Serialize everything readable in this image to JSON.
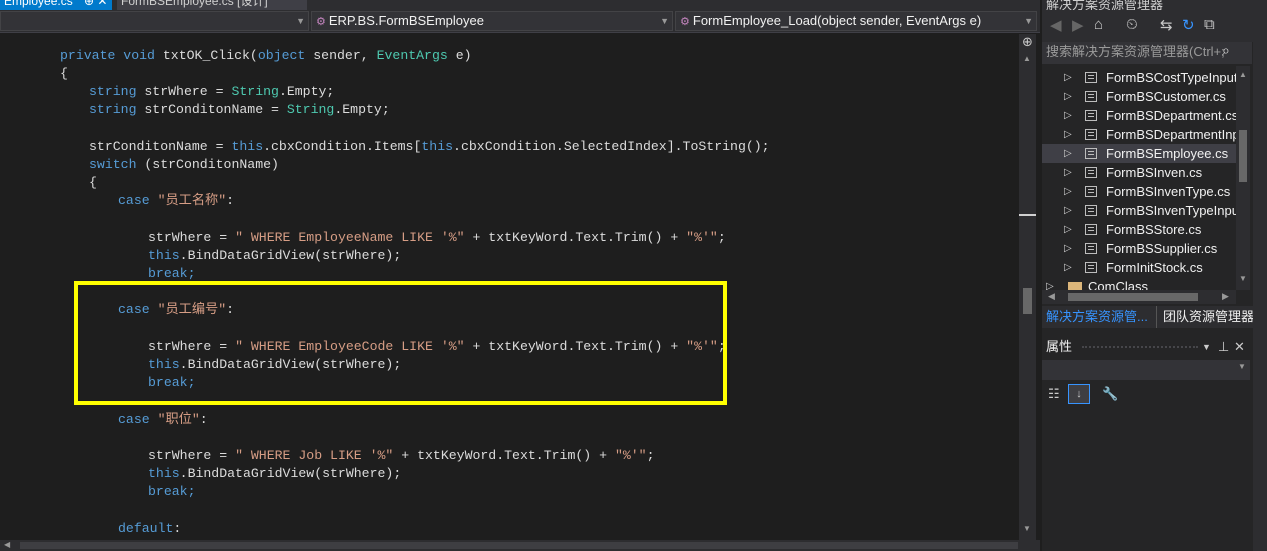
{
  "tabs": {
    "active": "Employee.cs",
    "active_close": "⊕ ✕",
    "second": "FormBSEmployee.cs [设计]"
  },
  "navbar": {
    "project_combo": "",
    "class_combo": "ERP.BS.FormBSEmployee",
    "member_combo": "FormEmployee_Load(object sender, EventArgs e)"
  },
  "code": {
    "method_sig_1": "private void",
    "method_sig_2": " txtOK_Click(",
    "method_sig_3": "object",
    "method_sig_4": " sender, ",
    "method_sig_5": "EventArgs",
    "method_sig_6": " e)",
    "open_brace": "{",
    "l1_kw": "string",
    "l1_a": " strWhere = ",
    "l1_ty": "String",
    "l1_b": ".Empty;",
    "l2_kw": "string",
    "l2_a": " strConditonName = ",
    "l2_ty": "String",
    "l2_b": ".Empty;",
    "l3_a": "strConditonName = ",
    "l3_kw1": "this",
    "l3_b": ".cbxCondition.Items[",
    "l3_kw2": "this",
    "l3_c": ".cbxCondition.SelectedIndex].ToString();",
    "l4_kw": "switch",
    "l4_a": " (strConditonName)",
    "l5": "{",
    "c1_kw": "case",
    "c1_st": " \"员工名称\"",
    "c1_end": ":",
    "c1_w_a": "strWhere = ",
    "c1_w_st1": "\" WHERE EmployeeName LIKE '%\"",
    "c1_w_b": " + txtKeyWord.Text.Trim() + ",
    "c1_w_st2": "\"%'\"",
    "c1_w_c": ";",
    "c1_bind_kw": "this",
    "c1_bind": ".BindDataGridView(strWhere);",
    "c1_break": "break;",
    "c2_kw": "case",
    "c2_st": " \"员工编号\"",
    "c2_end": ":",
    "c2_w_a": "strWhere = ",
    "c2_w_st1": "\" WHERE EmployeeCode LIKE '%\"",
    "c2_w_b": " + txtKeyWord.Text.Trim() + ",
    "c2_w_st2": "\"%'\"",
    "c2_w_c": ";",
    "c2_bind_kw": "this",
    "c2_bind": ".BindDataGridView(strWhere);",
    "c2_break": "break;",
    "c3_kw": "case",
    "c3_st": " \"职位\"",
    "c3_end": ":",
    "c3_w_a": "strWhere = ",
    "c3_w_st1": "\" WHERE Job LIKE '%\"",
    "c3_w_b": " + txtKeyWord.Text.Trim() + ",
    "c3_w_st2": "\"%'\"",
    "c3_w_c": ";",
    "c3_bind_kw": "this",
    "c3_bind": ".BindDataGridView(strWhere);",
    "c3_break": "break;",
    "default_kw": "default",
    "default_end": ":"
  },
  "solution_explorer": {
    "title": "解决方案资源管理器",
    "search_placeholder": "搜索解决方案资源管理器(Ctrl+;",
    "items": [
      {
        "label": "FormBSCostTypeInput"
      },
      {
        "label": "FormBSCustomer.cs"
      },
      {
        "label": "FormBSDepartment.cs"
      },
      {
        "label": "FormBSDepartmentInp"
      },
      {
        "label": "FormBSEmployee.cs"
      },
      {
        "label": "FormBSInven.cs"
      },
      {
        "label": "FormBSInvenType.cs"
      },
      {
        "label": "FormBSInvenTypeInpu"
      },
      {
        "label": "FormBSStore.cs"
      },
      {
        "label": "FormBSSupplier.cs"
      },
      {
        "label": "FormInitStock.cs"
      },
      {
        "label": "ComClass"
      }
    ],
    "selected_index": 4
  },
  "panel_tabs": {
    "solution": "解决方案资源管...",
    "team": "团队资源管理器"
  },
  "properties": {
    "title": "属性"
  },
  "colors": {
    "highlight_box": "#ffff00",
    "accent": "#007acc",
    "keyword": "#569cd6",
    "type": "#4ec9b0",
    "string": "#d69d85"
  }
}
